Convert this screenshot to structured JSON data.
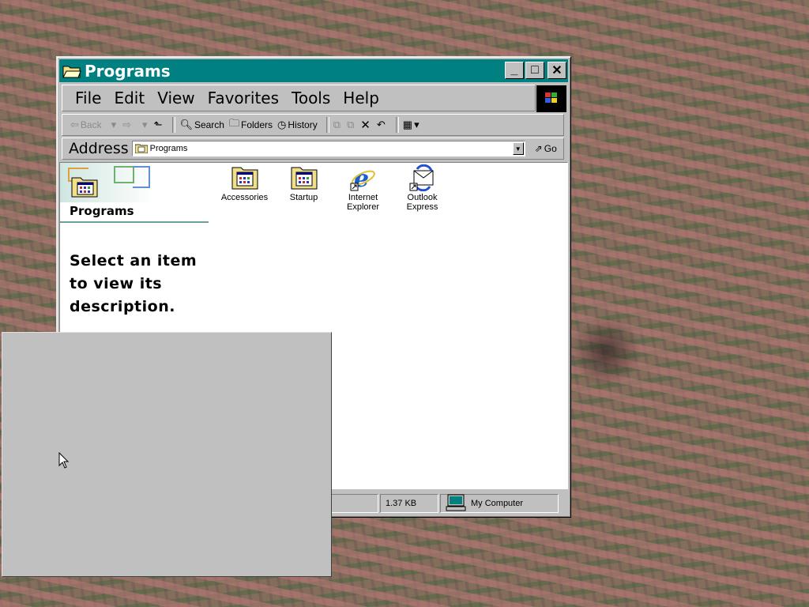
{
  "window": {
    "title": "Programs",
    "controls": {
      "minimize": "_",
      "maximize": "□",
      "close": "✕"
    }
  },
  "menu": [
    "File",
    "Edit",
    "View",
    "Favorites",
    "Tools",
    "Help"
  ],
  "toolbar": {
    "back": "Back",
    "search": "Search",
    "folders": "Folders",
    "history": "History"
  },
  "address": {
    "label": "Address",
    "value": "Programs",
    "go": "Go"
  },
  "left_pane": {
    "title": "Programs",
    "description": "Select an item to view its description."
  },
  "items": [
    {
      "label": "Accessories",
      "icon": "program-folder-icon"
    },
    {
      "label": "Startup",
      "icon": "program-folder-icon"
    },
    {
      "label": "Internet Explorer",
      "icon": "internet-explorer-icon"
    },
    {
      "label": "Outlook Express",
      "icon": "outlook-express-icon"
    }
  ],
  "status": {
    "size": "1.37 KB",
    "zone": "My Computer"
  },
  "colors": {
    "titlebar": "#008080",
    "face": "#c0c0c0"
  }
}
